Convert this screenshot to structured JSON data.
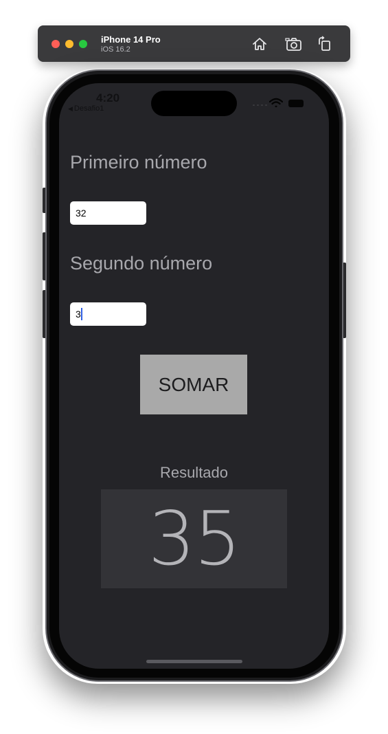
{
  "simulator": {
    "device_name": "iPhone 14 Pro",
    "os_version": "iOS 16.2",
    "home_icon": "home-icon",
    "screenshot_icon": "camera-icon",
    "rotate_icon": "rotate-icon"
  },
  "status_bar": {
    "time": "4:20",
    "back_label": "Desafio1",
    "back_icon": "back-triangle-icon",
    "wifi_icon": "wifi-icon",
    "battery_icon": "battery-icon"
  },
  "form": {
    "first_label": "Primeiro número",
    "first_value": "32",
    "second_label": "Segundo número",
    "second_value": "3",
    "button_label": "SOMAR"
  },
  "result": {
    "label": "Resultado",
    "value": "35"
  },
  "colors": {
    "screen_background": "#242428",
    "button_background": "#a9a9a9",
    "result_background": "#333337",
    "label_text": "#a8a8ad"
  }
}
